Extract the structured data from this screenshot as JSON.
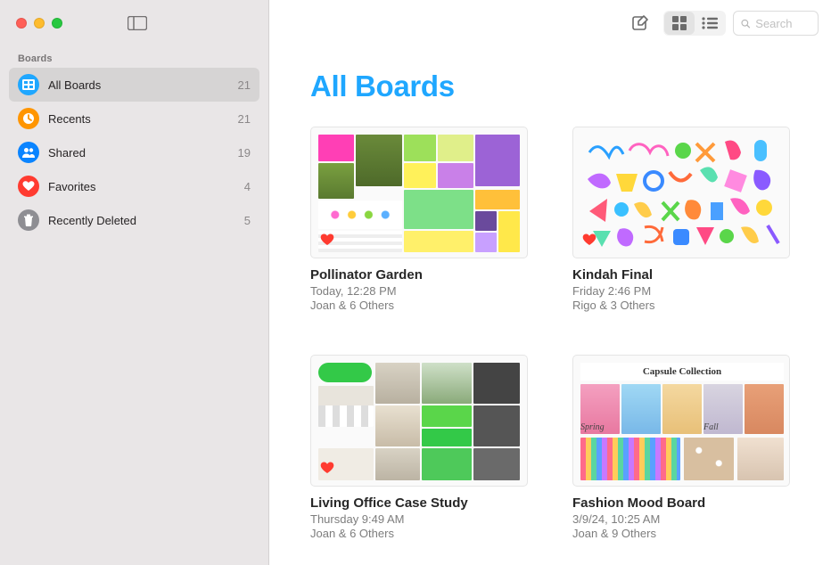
{
  "sidebar": {
    "section_label": "Boards",
    "items": [
      {
        "label": "All Boards",
        "count": "21",
        "icon": "board",
        "active": true
      },
      {
        "label": "Recents",
        "count": "21",
        "icon": "recent",
        "active": false
      },
      {
        "label": "Shared",
        "count": "19",
        "icon": "shared",
        "active": false
      },
      {
        "label": "Favorites",
        "count": "4",
        "icon": "favorites",
        "active": false
      },
      {
        "label": "Recently Deleted",
        "count": "5",
        "icon": "trash",
        "active": false
      }
    ]
  },
  "toolbar": {
    "search_placeholder": "Search",
    "view_mode": "grid"
  },
  "page": {
    "title": "All Boards"
  },
  "boards": [
    {
      "title": "Pollinator Garden",
      "time": "Today, 12:28 PM",
      "people": "Joan & 6 Others",
      "favorite": true
    },
    {
      "title": "Kindah Final",
      "time": "Friday 2:46 PM",
      "people": "Rigo & 3 Others",
      "favorite": true
    },
    {
      "title": "Living Office Case Study",
      "time": "Thursday 9:49 AM",
      "people": "Joan & 6 Others",
      "favorite": true
    },
    {
      "title": "Fashion Mood Board",
      "time": "3/9/24, 10:25 AM",
      "people": "Joan & 9 Others",
      "favorite": false
    }
  ]
}
